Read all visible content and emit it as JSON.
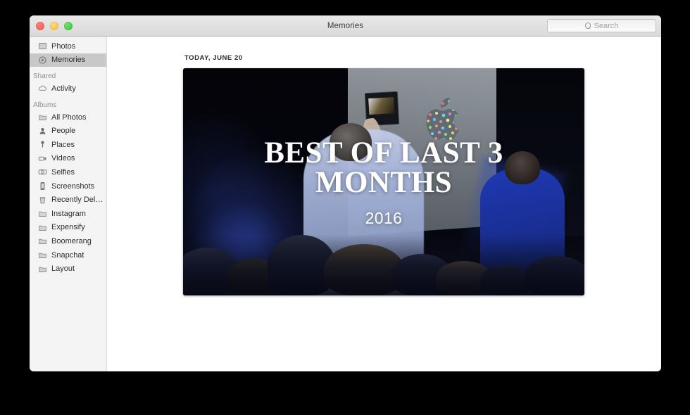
{
  "window": {
    "title": "Memories",
    "traffic_lights": [
      {
        "name": "close",
        "color": "#f25a4e"
      },
      {
        "name": "minimize",
        "color": "#f2bc3f"
      },
      {
        "name": "zoom",
        "color": "#3cc03a"
      }
    ]
  },
  "search": {
    "placeholder": "Search",
    "value": "",
    "icon": "search-icon"
  },
  "sidebar": {
    "library": [
      {
        "label": "Photos",
        "icon": "photos-icon",
        "selected": false
      },
      {
        "label": "Memories",
        "icon": "memories-icon",
        "selected": true
      }
    ],
    "shared_header": "Shared",
    "shared": [
      {
        "label": "Activity",
        "icon": "cloud-icon",
        "selected": false
      }
    ],
    "albums_header": "Albums",
    "albums": [
      {
        "label": "All Photos",
        "icon": "album-icon",
        "selected": false
      },
      {
        "label": "People",
        "icon": "person-icon",
        "selected": false
      },
      {
        "label": "Places",
        "icon": "pin-icon",
        "selected": false
      },
      {
        "label": "Videos",
        "icon": "video-icon",
        "selected": false
      },
      {
        "label": "Selfies",
        "icon": "camera-icon",
        "selected": false
      },
      {
        "label": "Screenshots",
        "icon": "phone-icon",
        "selected": false
      },
      {
        "label": "Recently Dele…",
        "icon": "trash-icon",
        "selected": false
      },
      {
        "label": "Instagram",
        "icon": "album-icon",
        "selected": false
      },
      {
        "label": "Expensify",
        "icon": "album-icon",
        "selected": false
      },
      {
        "label": "Boomerang",
        "icon": "album-icon",
        "selected": false
      },
      {
        "label": "Snapchat",
        "icon": "album-icon",
        "selected": false
      },
      {
        "label": "Layout",
        "icon": "album-icon",
        "selected": false
      }
    ]
  },
  "content": {
    "date_header": "TODAY, JUNE 20",
    "memory": {
      "title": "BEST OF LAST 3 MONTHS",
      "subtitle": "2016",
      "scene": "audience at a keynote presentation facing a lit projection screen showing a dotted Apple logo"
    }
  },
  "colors": {
    "window_chrome": "#e4e4e4",
    "sidebar_bg": "#f4f4f4",
    "sidebar_selected": "#c8c8c8",
    "content_bg": "#ffffff",
    "text_primary": "#2f2f2f",
    "text_secondary": "#8e8e8e",
    "overlay_text": "#ffffff",
    "desktop_bg": "#000000"
  }
}
